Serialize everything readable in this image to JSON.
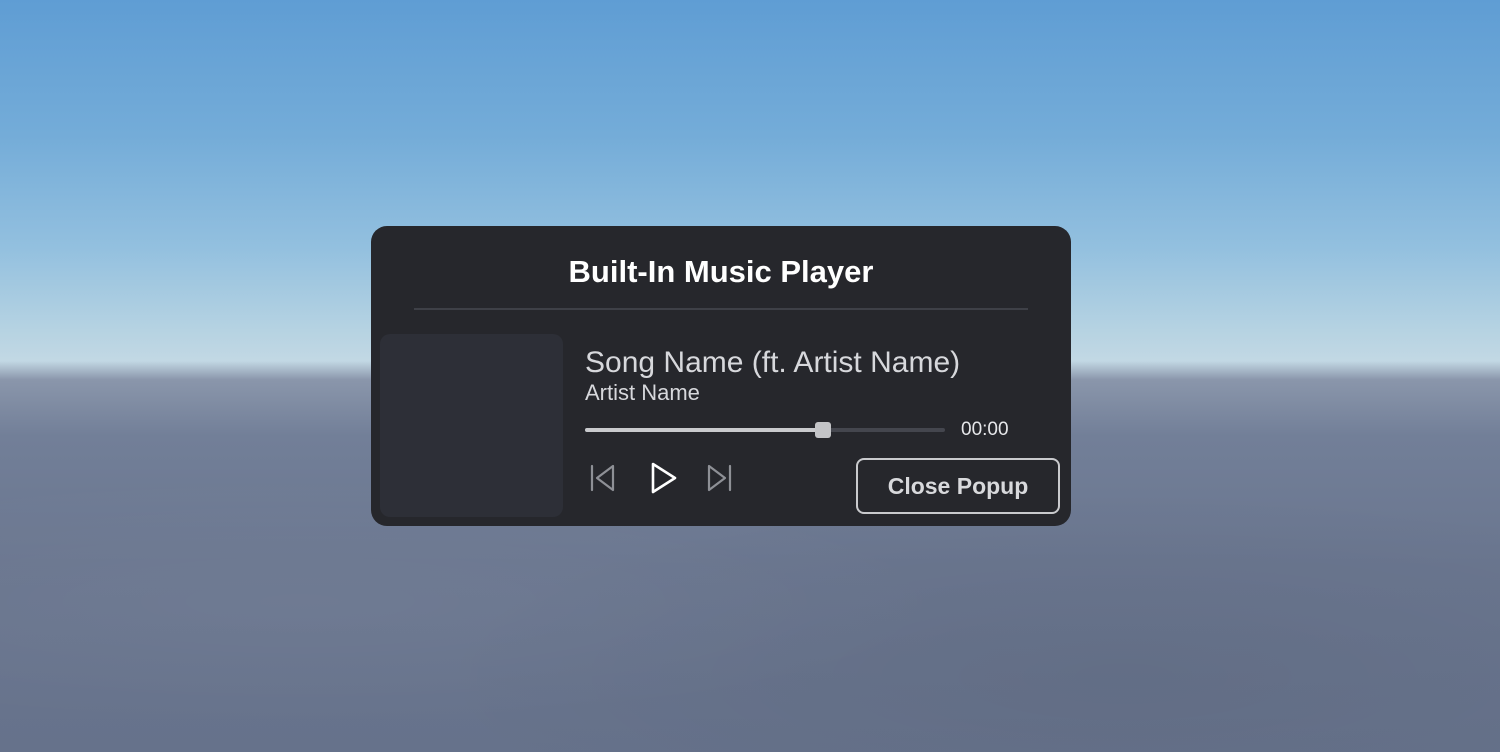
{
  "popup": {
    "title": "Built-In Music Player",
    "song_name": "Song Name (ft. Artist Name)",
    "artist_name": "Artist Name",
    "progress_fraction": 0.66,
    "time": "00:00",
    "close_label": "Close Popup"
  },
  "controls": {
    "previous_icon": "skip-previous-icon",
    "play_icon": "play-icon",
    "next_icon": "skip-next-icon"
  },
  "colors": {
    "panel_background": "#26272c",
    "album_art_placeholder": "#2d2f37",
    "progress_fill": "#c9cacd",
    "progress_track": "#44464e",
    "text": "#d7d8dc"
  }
}
